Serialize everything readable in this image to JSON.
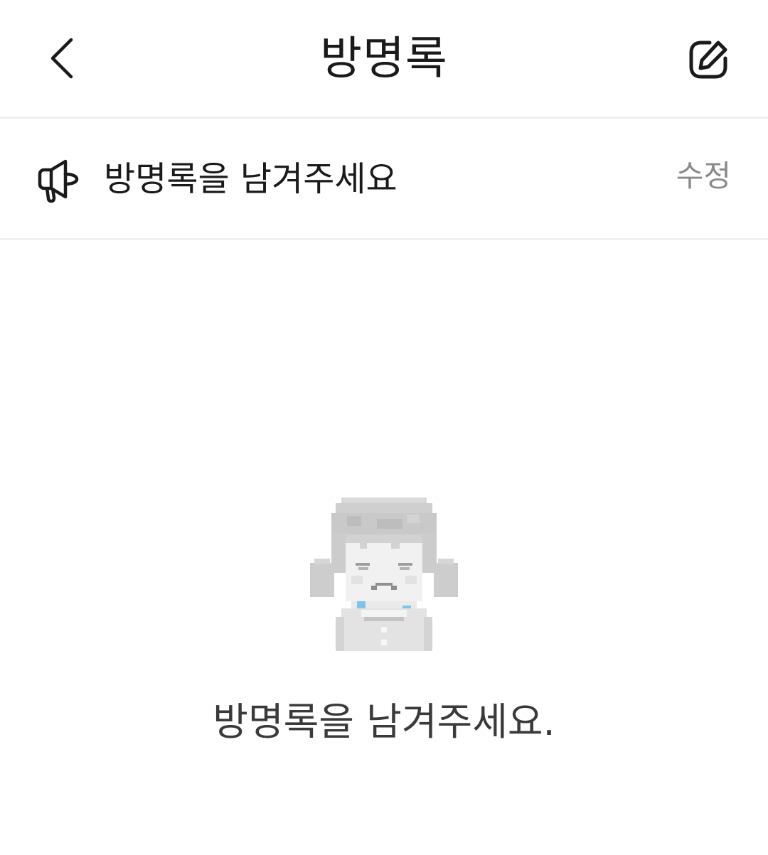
{
  "header": {
    "title": "방명록",
    "back_icon": "chevron-left-icon",
    "write_icon": "edit-square-icon"
  },
  "notice": {
    "icon": "megaphone-icon",
    "text": "방명록을 남겨주세요",
    "edit_label": "수정"
  },
  "empty_state": {
    "illustration": "crying-girl-pixel-illustration",
    "message": "방명록을 남겨주세요."
  },
  "colors": {
    "background": "#ffffff",
    "divider": "#f0f0f0",
    "text_primary": "#1a1a1a",
    "text_secondary": "#8a8a8a",
    "tear_accent": "#7fc4e8"
  }
}
